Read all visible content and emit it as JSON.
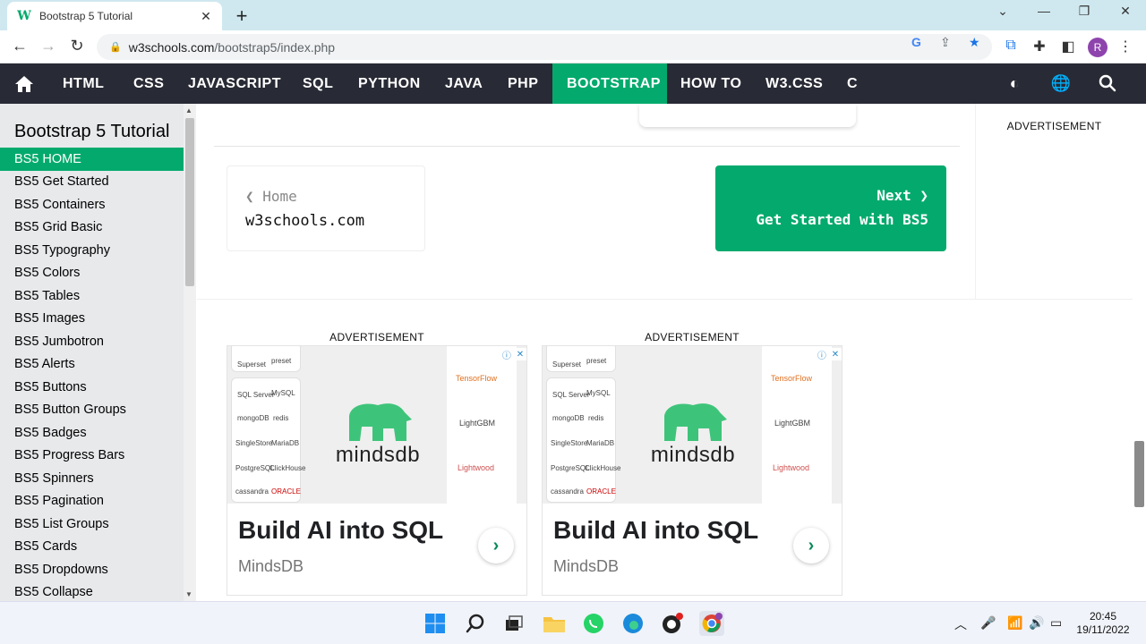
{
  "browser": {
    "tab_title": "Bootstrap 5 Tutorial",
    "tab_favicon": "W",
    "url_host": "w3schools.com",
    "url_path": "/bootstrap5/index.php",
    "profile_initial": "R"
  },
  "topnav": {
    "items": [
      "HTML",
      "CSS",
      "JAVASCRIPT",
      "SQL",
      "PYTHON",
      "JAVA",
      "PHP",
      "BOOTSTRAP",
      "HOW TO",
      "W3.CSS",
      "C"
    ],
    "active": "BOOTSTRAP"
  },
  "sidebar": {
    "title": "Bootstrap 5 Tutorial",
    "items": [
      "BS5 HOME",
      "BS5 Get Started",
      "BS5 Containers",
      "BS5 Grid Basic",
      "BS5 Typography",
      "BS5 Colors",
      "BS5 Tables",
      "BS5 Images",
      "BS5 Jumbotron",
      "BS5 Alerts",
      "BS5 Buttons",
      "BS5 Button Groups",
      "BS5 Badges",
      "BS5 Progress Bars",
      "BS5 Spinners",
      "BS5 Pagination",
      "BS5 List Groups",
      "BS5 Cards",
      "BS5 Dropdowns",
      "BS5 Collapse"
    ],
    "active": "BS5 HOME"
  },
  "pager": {
    "prev_label": "❮ Home",
    "prev_sub": "w3schools.com",
    "next_label": "Next ❯",
    "next_sub": "Get Started with BS5"
  },
  "ads": {
    "label": "ADVERTISEMENT",
    "brand_logo_text": "mindsdb",
    "headline": "Build AI into SQL",
    "brand": "MindsDB",
    "left_logos": [
      "Superset",
      "preset",
      "SQL Server",
      "MySQL",
      "mongoDB",
      "redis",
      "SingleStore",
      "MariaDB",
      "PostgreSQL",
      "ClickHouse",
      "cassandra",
      "ORACLE"
    ],
    "right_logos": [
      "TensorFlow",
      "LightGBM",
      "Lightwood"
    ]
  },
  "taskbar": {
    "time": "20:45",
    "date": "19/11/2022"
  },
  "colors": {
    "accent": "#04aa6d",
    "nav_bg": "#282a35",
    "sidebar_bg": "#e7e9eb"
  }
}
